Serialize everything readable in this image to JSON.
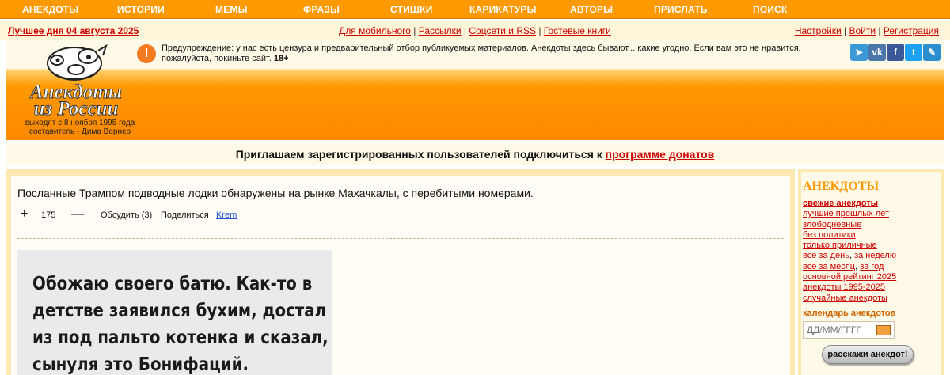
{
  "nav": {
    "items": [
      "АНЕКДОТЫ",
      "ИСТОРИИ",
      "МЕМЫ",
      "ФРАЗЫ",
      "СТИШКИ",
      "КАРИКАТУРЫ",
      "АВТОРЫ",
      "ПРИСЛАТЬ",
      "ПОИСК"
    ]
  },
  "subbar": {
    "date": "Лучшее дня 04 августа 2025",
    "links": [
      "Для мобильного",
      "Рассылки",
      "Соцсети и RSS",
      "Гостевые книги"
    ],
    "right": [
      "Настройки",
      "Войти",
      "Регистрация"
    ],
    "sep": " | "
  },
  "header": {
    "logo_line1": "Анекдоты",
    "logo_line2": "из России",
    "tagline1": "выходят с 8 ноября 1995 года",
    "tagline2": "составитель - Дима Вернер",
    "warning": "Предупреждение: у нас есть цензура и предварительный отбор публикуемых материалов. Анекдоты здесь бывают... какие угодно. Если вам это не нравится, пожалуйста, покиньте сайт.",
    "age": "18+",
    "warn_glyph": "!",
    "social": [
      {
        "icon": "telegram-icon",
        "glyph": "➤",
        "color": "#3b9ad6"
      },
      {
        "icon": "vk-icon",
        "glyph": "vk",
        "color": "#4a76a8"
      },
      {
        "icon": "facebook-icon",
        "glyph": "f",
        "color": "#3b5998"
      },
      {
        "icon": "twitter-icon",
        "glyph": "t",
        "color": "#1da1f2"
      },
      {
        "icon": "livejournal-icon",
        "glyph": "✎",
        "color": "#2b8fcf"
      }
    ]
  },
  "banner": {
    "text": "Приглашаем зарегистрированных пользователей подключиться к ",
    "link": "программе донатов"
  },
  "joke": {
    "text": "Посланные Трампом подводные лодки обнаружены на рынке Махачкалы, с перебитыми номерами.",
    "plus": "+",
    "rating": "175",
    "minus": "—",
    "discuss": "Обсудить (3)",
    "share": "Поделиться",
    "author": "Krem"
  },
  "meme": {
    "lines": [
      "Обожаю своего батю. Как-то в",
      "детстве заявился бухим, достал",
      "из под пальто котенка и сказал,",
      "сынуля это Бонифаций."
    ]
  },
  "sidebar": {
    "title": "АНЕКДОТЫ",
    "links": [
      [
        "свежие анекдоты"
      ],
      [
        "лучшие прошлых лет"
      ],
      [
        "злободневные"
      ],
      [
        "без политики"
      ],
      [
        "только приличные"
      ],
      [
        "все за день",
        "за неделю"
      ],
      [
        "все за месяц",
        "за год"
      ],
      [
        "основной рейтинг 2025"
      ],
      [
        "анекдоты 1995-2025"
      ],
      [
        "случайные анекдоты"
      ]
    ],
    "calendar_title": "календарь анекдотов",
    "calendar_placeholder": "ДД/ММ/ГГГГ",
    "tell_button": "расскажи анекдот!"
  },
  "colors": {
    "accent": "#ff9900",
    "link": "#cc0000"
  }
}
